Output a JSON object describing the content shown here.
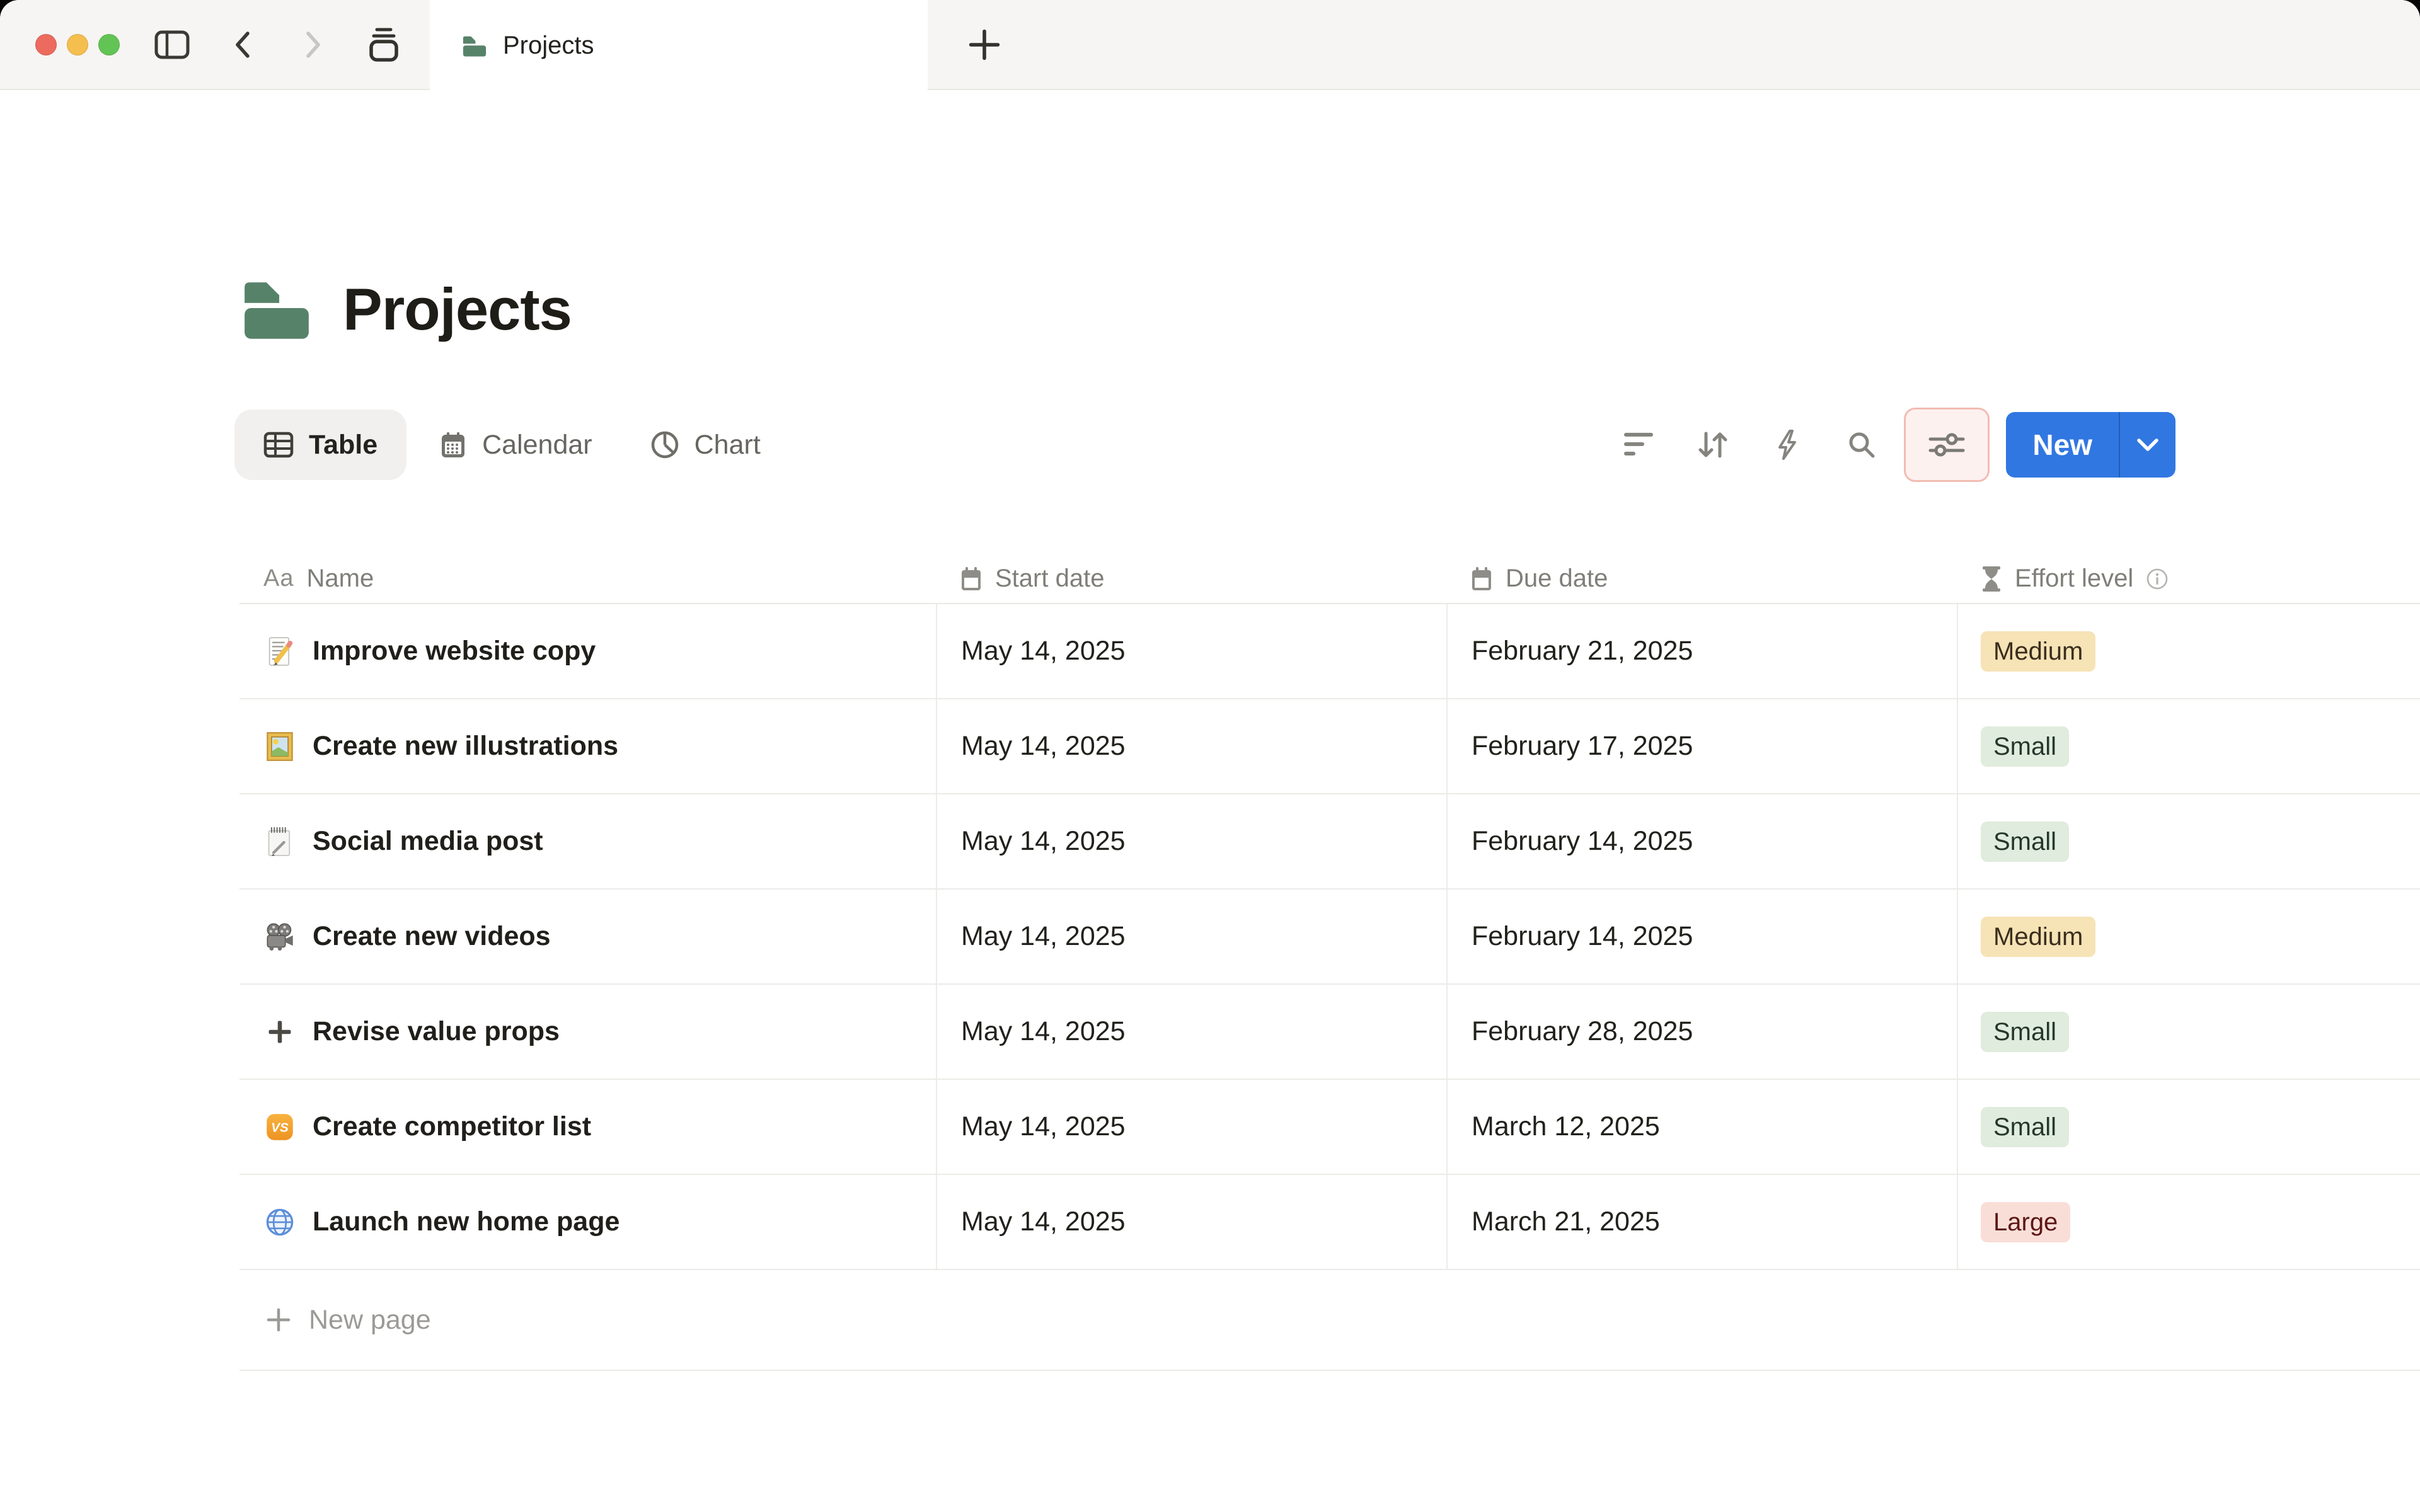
{
  "window": {
    "traffic_lights": [
      "close",
      "minimize",
      "zoom"
    ],
    "controls": [
      "sidebar-toggle",
      "back",
      "forward",
      "tab-stack",
      "new-tab"
    ],
    "tab": {
      "label": "Projects",
      "icon": "folder"
    }
  },
  "page": {
    "title": "Projects",
    "icon": "folder"
  },
  "views": [
    {
      "label": "Table",
      "icon": "table-grid",
      "active": true
    },
    {
      "label": "Calendar",
      "icon": "calendar",
      "active": false
    },
    {
      "label": "Chart",
      "icon": "pie-chart",
      "active": false
    }
  ],
  "toolbar": {
    "icons": [
      "filter",
      "sort",
      "automation",
      "search",
      "view-settings"
    ],
    "view_settings_highlighted": true,
    "new_button": {
      "label": "New",
      "has_dropdown": true
    }
  },
  "table": {
    "aa_icon_text": "Aa",
    "columns": [
      {
        "label": "Name",
        "icon": "text-aa"
      },
      {
        "label": "Start date",
        "icon": "calendar"
      },
      {
        "label": "Due date",
        "icon": "calendar"
      },
      {
        "label": "Effort level",
        "icon": "hourglass",
        "has_info": true
      }
    ],
    "rows": [
      {
        "icon": "memo",
        "name": "Improve website copy",
        "start_date": "May 14, 2025",
        "due_date": "February 21, 2025",
        "effort": {
          "label": "Medium",
          "color": "yellow"
        }
      },
      {
        "icon": "framed-picture",
        "name": "Create new illustrations",
        "start_date": "May 14, 2025",
        "due_date": "February 17, 2025",
        "effort": {
          "label": "Small",
          "color": "green"
        }
      },
      {
        "icon": "spiral-notepad",
        "name": "Social media post",
        "start_date": "May 14, 2025",
        "due_date": "February 14, 2025",
        "effort": {
          "label": "Small",
          "color": "green"
        }
      },
      {
        "icon": "movie-camera",
        "name": "Create new videos",
        "start_date": "May 14, 2025",
        "due_date": "February 14, 2025",
        "effort": {
          "label": "Medium",
          "color": "yellow"
        }
      },
      {
        "icon": "plus",
        "name": "Revise value props",
        "start_date": "May 14, 2025",
        "due_date": "February 28, 2025",
        "effort": {
          "label": "Small",
          "color": "green"
        }
      },
      {
        "icon": "vs",
        "name": "Create competitor list",
        "start_date": "May 14, 2025",
        "due_date": "March 12, 2025",
        "effort": {
          "label": "Small",
          "color": "green"
        }
      },
      {
        "icon": "globe",
        "name": "Launch new home page",
        "start_date": "May 14, 2025",
        "due_date": "March 21, 2025",
        "effort": {
          "label": "Large",
          "color": "red"
        }
      }
    ]
  },
  "footer": {
    "new_page_label": "New page"
  },
  "colors": {
    "accent_blue": "#3177e2",
    "folder_green": "#57826a",
    "tabbar_bg": "#f6f5f3",
    "settings_highlight_bg": "#fdf1ef",
    "settings_highlight_border": "#f2bcb3",
    "badge_yellow_bg": "#f6e3b6",
    "badge_green_bg": "#e0ecdd",
    "badge_red_bg": "#f9ded8",
    "badge_red_text": "#5d1715"
  }
}
